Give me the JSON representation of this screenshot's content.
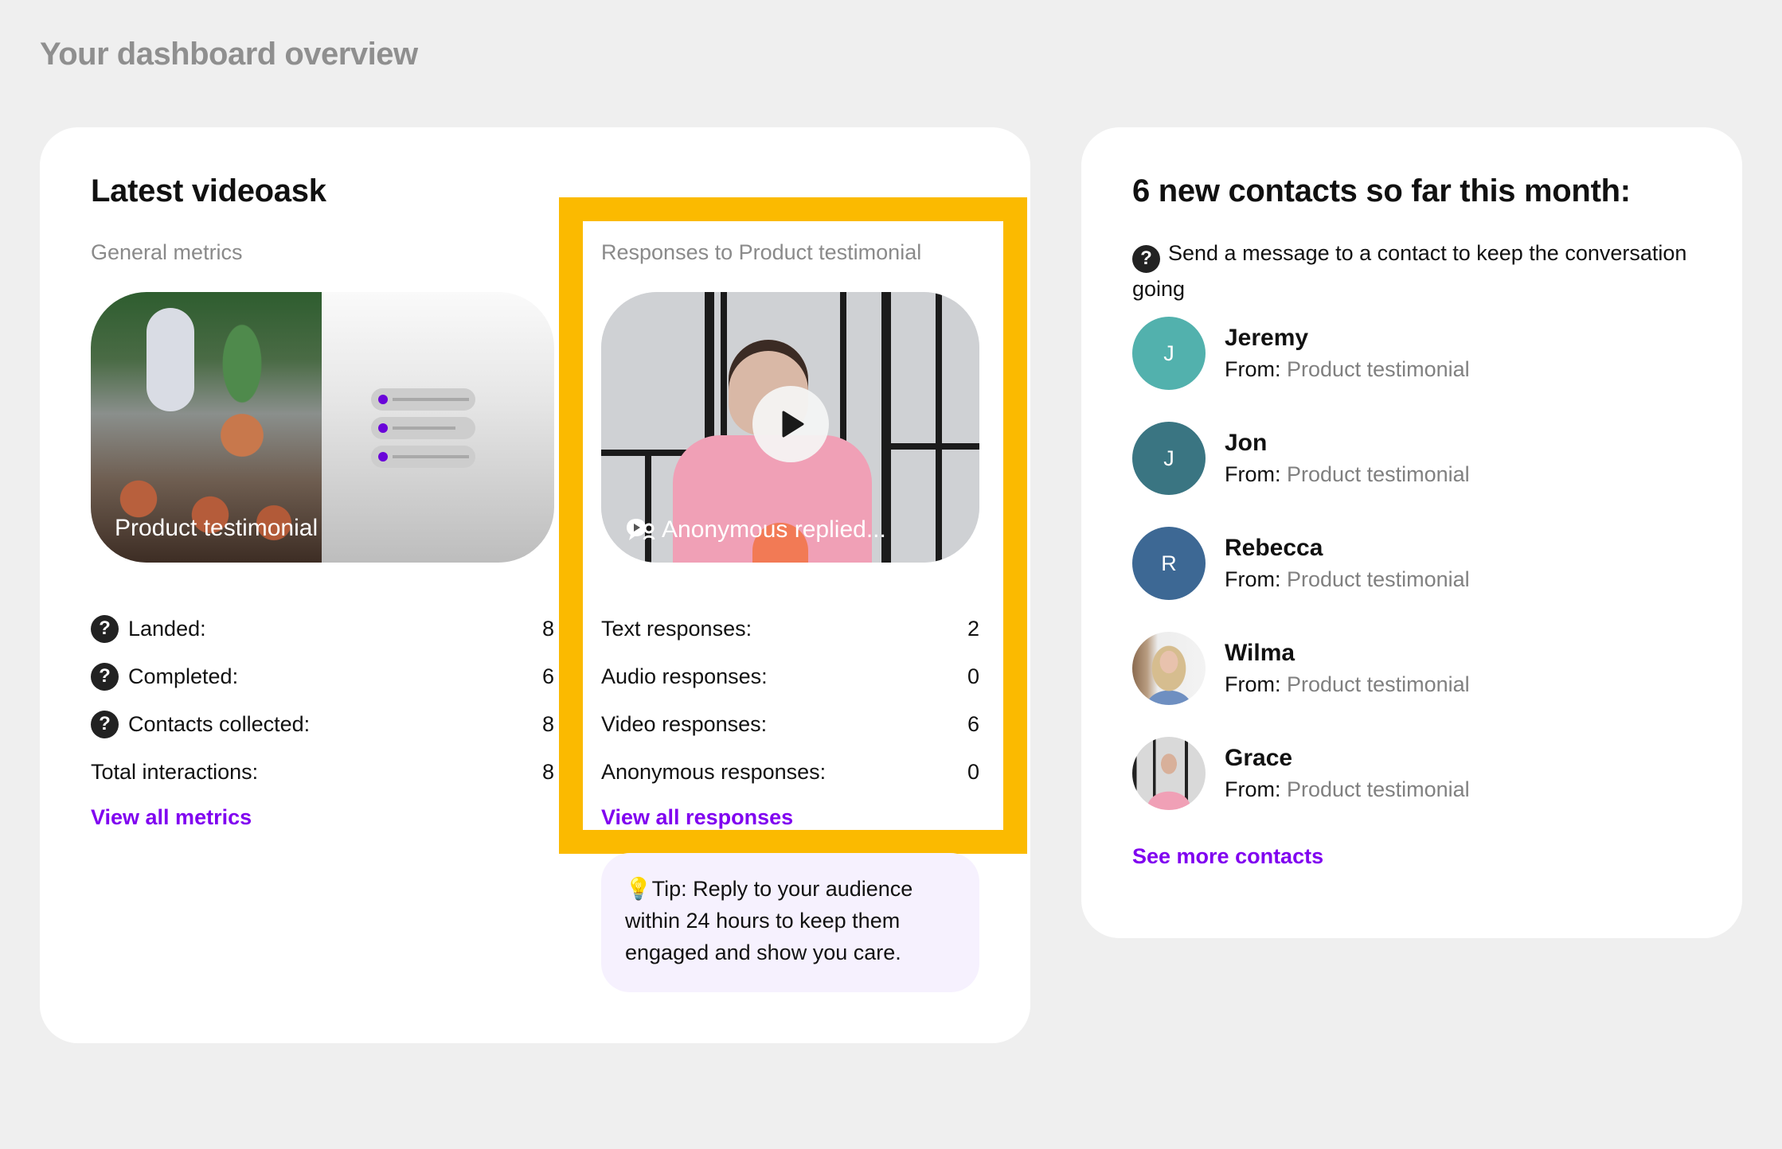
{
  "page": {
    "title": "Your dashboard overview"
  },
  "latest_videoask": {
    "title": "Latest videoask",
    "general_metrics": {
      "heading": "General metrics",
      "thumbnail_caption": "Product testimonial",
      "metrics": [
        {
          "label": "Landed:",
          "value": "8",
          "has_help_icon": true
        },
        {
          "label": "Completed:",
          "value": "6",
          "has_help_icon": true
        },
        {
          "label": "Contacts collected:",
          "value": "8",
          "has_help_icon": true
        },
        {
          "label": "Total interactions:",
          "value": "8",
          "has_help_icon": false
        }
      ],
      "link_label": "View all metrics"
    },
    "responses": {
      "heading": "Responses to Product testimonial",
      "video_caption": "Anonymous replied...",
      "metrics": [
        {
          "label": "Text responses:",
          "value": "2"
        },
        {
          "label": "Audio responses:",
          "value": "0"
        },
        {
          "label": "Video responses:",
          "value": "6"
        },
        {
          "label": "Anonymous responses:",
          "value": "0"
        }
      ],
      "link_label": "View all responses"
    },
    "tip": {
      "icon": "💡",
      "text": "Tip: Reply to your audience within 24 hours to keep them engaged and show you care."
    }
  },
  "contacts": {
    "title": "6 new contacts so far this month:",
    "hint": "Send a message to a contact to keep the conversation going",
    "from_label": "From:",
    "items": [
      {
        "name": "Jeremy",
        "initial": "J",
        "source": "Product testimonial",
        "avatar_color": "#52b1ad",
        "avatar_type": "initial"
      },
      {
        "name": "Jon",
        "initial": "J",
        "source": "Product testimonial",
        "avatar_color": "#3a7582",
        "avatar_type": "initial"
      },
      {
        "name": "Rebecca",
        "initial": "R",
        "source": "Product testimonial",
        "avatar_color": "#3d6894",
        "avatar_type": "initial"
      },
      {
        "name": "Wilma",
        "initial": "",
        "source": "Product testimonial",
        "avatar_color": "",
        "avatar_type": "photo"
      },
      {
        "name": "Grace",
        "initial": "",
        "source": "Product testimonial",
        "avatar_color": "",
        "avatar_type": "photo"
      }
    ],
    "link_label": "See more contacts"
  },
  "colors": {
    "accent_link": "#8000f0",
    "highlight_frame": "#fbba00",
    "tip_background": "#f6f1fe",
    "page_background": "#efefef"
  }
}
